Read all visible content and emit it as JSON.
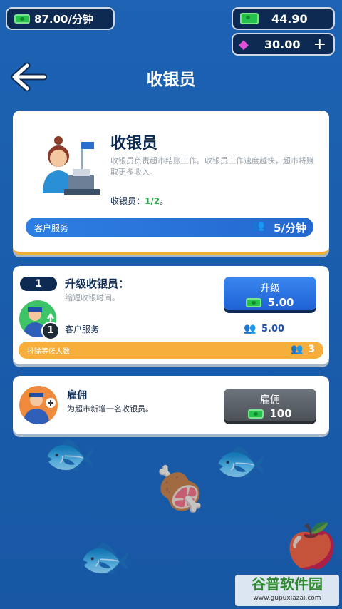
{
  "top": {
    "income": "87.00/分钟",
    "cash": "44.90",
    "gems": "30.00",
    "add_label": "+"
  },
  "header": {
    "title": "收银员"
  },
  "info_card": {
    "title": "收银员",
    "description": "收银员负责超市结账工作。收银员工作速度越快，超市将赚取更多收入。",
    "count_label": "收银员：",
    "count_value": "1/2",
    "count_suffix": "。",
    "service_label": "客户服务",
    "service_value": "5/分钟"
  },
  "upgrade_card": {
    "level": "1",
    "title": "升级收银员：",
    "subtitle": "缩短收银时间。",
    "badge": "1",
    "service_label": "客户服务",
    "service_value": "5.00",
    "button_label": "升级",
    "button_price": "5.00",
    "queue_label": "排除等候人数",
    "queue_value": "3"
  },
  "hire_card": {
    "title": "雇佣",
    "subtitle": "为超市新增一名收银员。",
    "button_label": "雇佣",
    "button_price": "100"
  },
  "watermark": {
    "name": "谷普软件园",
    "url": "www.gupuxiazai.com"
  },
  "colors": {
    "background": "#1a5cab",
    "service_bar": "#2a7be0",
    "queue_bar": "#f7ae3b",
    "upgrade_button": "#1f62d6",
    "hire_button": "#555b63",
    "cash": "#27c24c"
  }
}
